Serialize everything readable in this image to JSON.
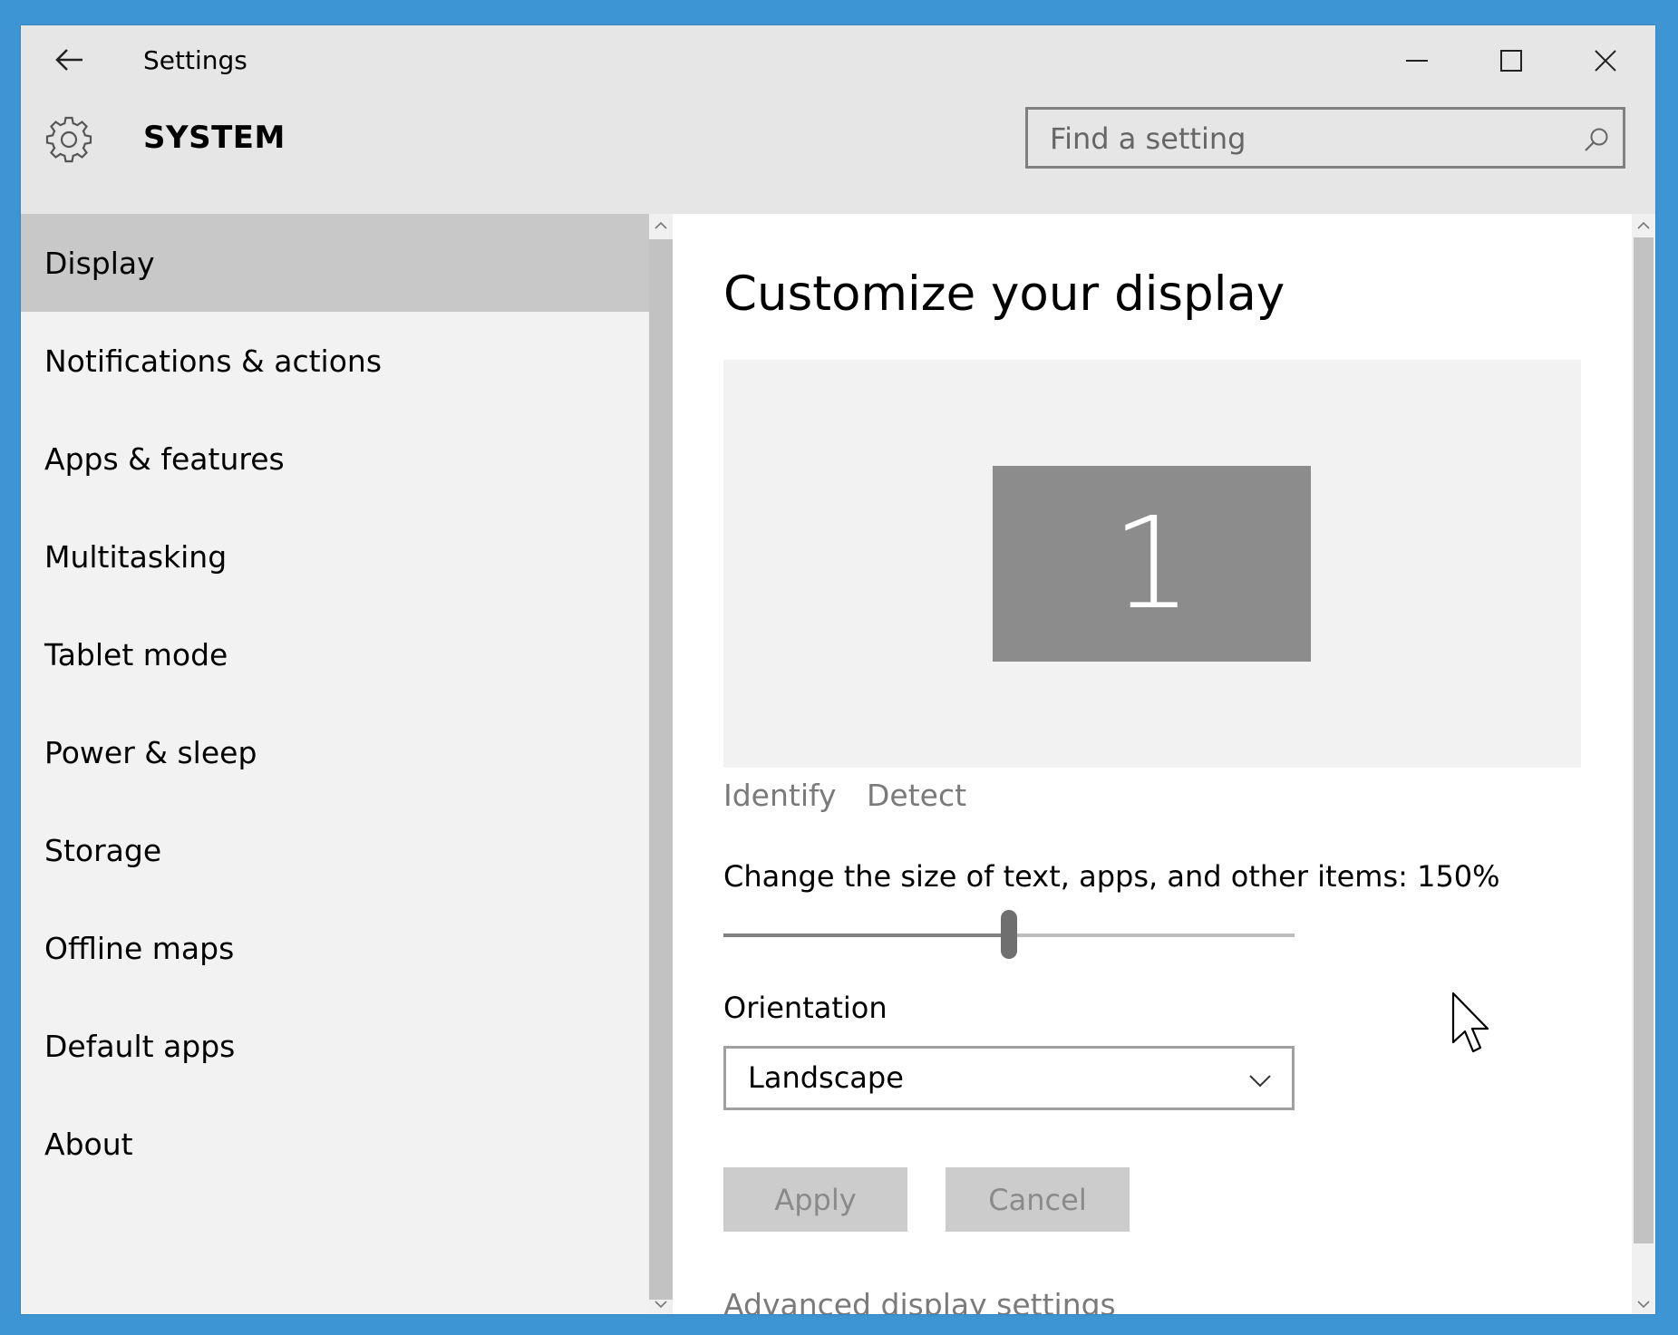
{
  "window": {
    "title": "Settings",
    "back_icon": "back-arrow-icon",
    "controls": {
      "minimize_icon": "minimize-icon",
      "maximize_icon": "maximize-icon",
      "close_icon": "close-icon"
    }
  },
  "header": {
    "icon": "gear-icon",
    "section": "SYSTEM",
    "search": {
      "placeholder": "Find a setting",
      "value": "",
      "icon": "search-icon"
    }
  },
  "sidebar": {
    "items": [
      {
        "label": "Display",
        "selected": true
      },
      {
        "label": "Notifications & actions",
        "selected": false
      },
      {
        "label": "Apps & features",
        "selected": false
      },
      {
        "label": "Multitasking",
        "selected": false
      },
      {
        "label": "Tablet mode",
        "selected": false
      },
      {
        "label": "Power & sleep",
        "selected": false
      },
      {
        "label": "Storage",
        "selected": false
      },
      {
        "label": "Offline maps",
        "selected": false
      },
      {
        "label": "Default apps",
        "selected": false
      },
      {
        "label": "About",
        "selected": false
      }
    ]
  },
  "main": {
    "title": "Customize your display",
    "monitor_number": "1",
    "identify_label": "Identify",
    "detect_label": "Detect",
    "scale_label": "Change the size of text, apps, and other items: 150%",
    "scale_slider_fraction": 0.5,
    "orientation_label": "Orientation",
    "orientation_value": "Landscape",
    "apply_label": "Apply",
    "cancel_label": "Cancel",
    "advanced_link": "Advanced display settings"
  },
  "colors": {
    "accent_background": "#3d95d4",
    "selected_nav": "#c8c8c8",
    "monitor_tile": "#8c8c8c"
  }
}
